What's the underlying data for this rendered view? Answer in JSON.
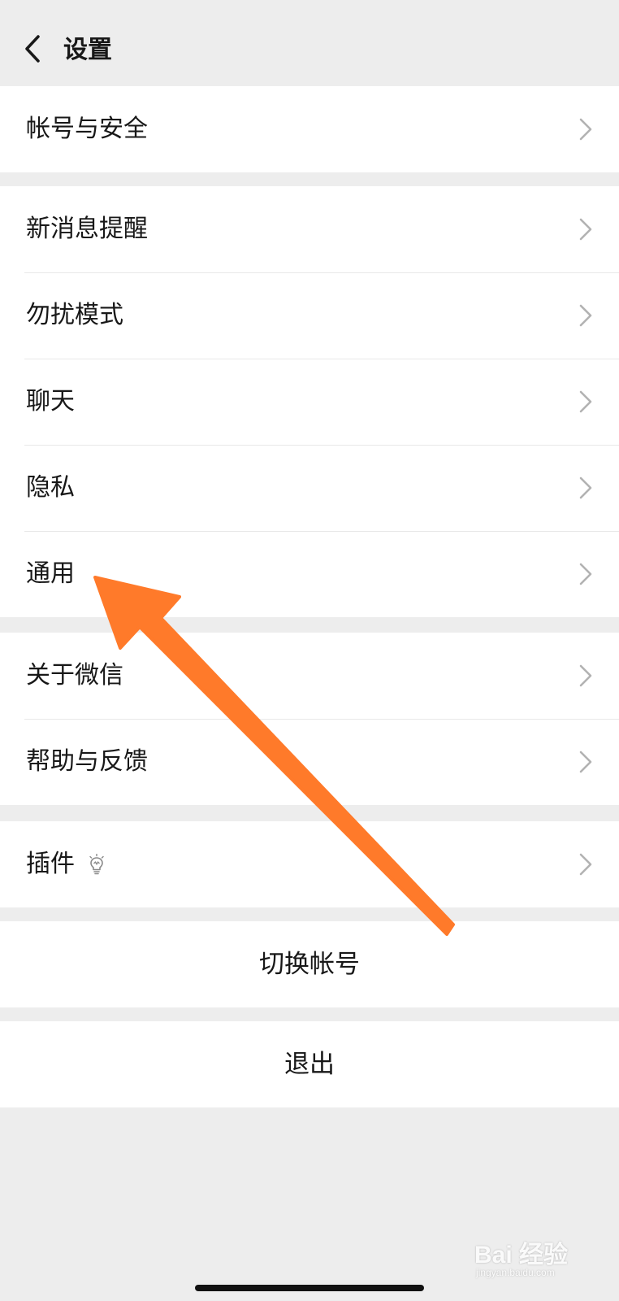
{
  "header": {
    "title": "设置",
    "back_icon": "chevron-left-icon"
  },
  "groups": [
    {
      "items": [
        {
          "label": "帐号与安全"
        }
      ]
    },
    {
      "items": [
        {
          "label": "新消息提醒"
        },
        {
          "label": "勿扰模式"
        },
        {
          "label": "聊天"
        },
        {
          "label": "隐私"
        },
        {
          "label": "通用"
        }
      ]
    },
    {
      "items": [
        {
          "label": "关于微信"
        },
        {
          "label": "帮助与反馈"
        }
      ]
    },
    {
      "items": [
        {
          "label": "插件",
          "icon": "lightbulb-icon"
        }
      ]
    }
  ],
  "actions": {
    "switch_account": "切换帐号",
    "logout": "退出"
  },
  "annotation": {
    "arrow_color": "#FF7A2A",
    "target": "通用"
  },
  "watermark": {
    "main": "Bai 经验",
    "sub": "jingyan.baidu.com"
  },
  "colors": {
    "background": "#EDEDED",
    "cell": "#FFFFFF",
    "text": "#181818",
    "chevron": "#B2B2B2",
    "divider": "#E8E8E8"
  }
}
